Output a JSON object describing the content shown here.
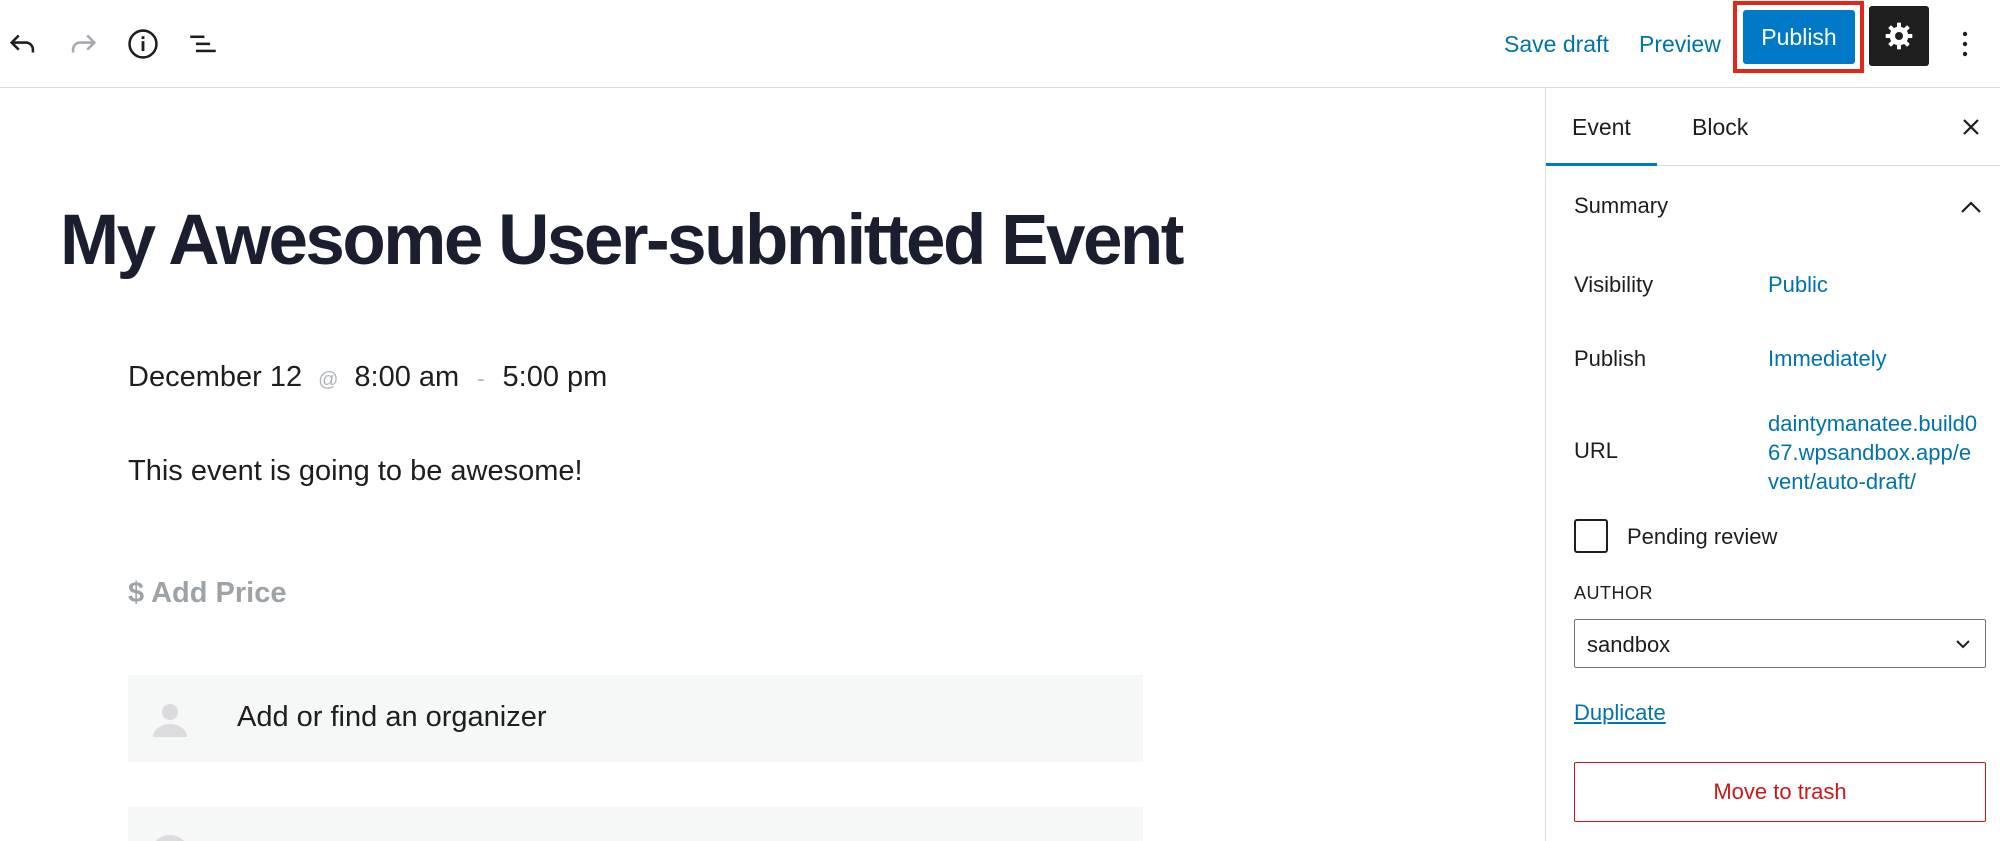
{
  "toolbar": {
    "save_draft": "Save draft",
    "preview": "Preview",
    "publish": "Publish",
    "icons": [
      "undo-icon",
      "redo-icon",
      "info-icon",
      "list-view-icon",
      "gear-icon",
      "more-options-icon"
    ]
  },
  "editor": {
    "title": "My Awesome User-submitted Event",
    "date": "December 12",
    "at_separator": "@",
    "start_time": "8:00 am",
    "range_separator": "-",
    "end_time": "5:00 pm",
    "body": "This event is going to be awesome!",
    "add_price": "$ Add Price",
    "organizer_placeholder": "Add or find an organizer"
  },
  "sidebar": {
    "tabs": [
      {
        "label": "Event",
        "active": true
      },
      {
        "label": "Block",
        "active": false
      }
    ],
    "summary_title": "Summary",
    "visibility_label": "Visibility",
    "visibility_value": "Public",
    "publish_label": "Publish",
    "publish_value": "Immediately",
    "url_label": "URL",
    "url_value": "daintymanatee.build067.wpsandbox.app/event/auto-draft/",
    "pending_review_label": "Pending review",
    "pending_review_checked": false,
    "author_label": "AUTHOR",
    "author_value": "sandbox",
    "duplicate": "Duplicate",
    "move_to_trash": "Move to trash"
  },
  "colors": {
    "accent": "#0079c6",
    "link": "#0073aa",
    "highlight_outline": "#e0281a",
    "danger": "#cc1818"
  }
}
